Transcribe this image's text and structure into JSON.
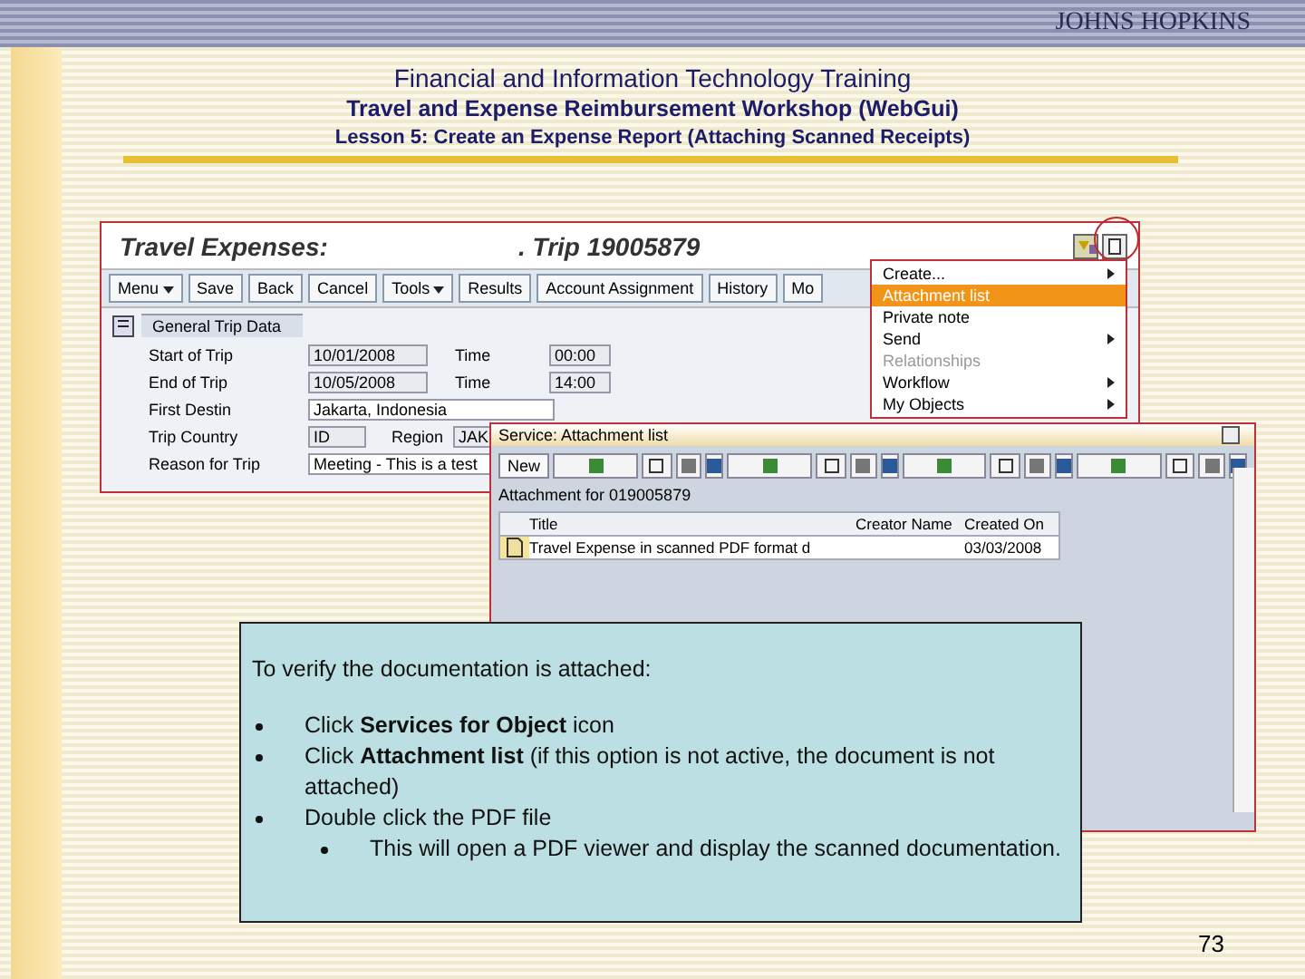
{
  "slide": {
    "logo": "JOHNS HOPKINS",
    "titles": [
      "Financial and Information Technology Training",
      "Travel and Expense Reimbursement Workshop (WebGui)",
      "Lesson 5: Create an Expense Report (Attaching Scanned Receipts)"
    ],
    "page_number": "73"
  },
  "sap": {
    "title": "Travel Expenses:",
    "trip": ". Trip 19005879",
    "toolbar": [
      {
        "label": "Menu",
        "dropdown": true
      },
      {
        "label": "Save",
        "dropdown": false
      },
      {
        "label": "Back",
        "dropdown": false
      },
      {
        "label": "Cancel",
        "dropdown": false
      },
      {
        "label": "Tools",
        "dropdown": true
      },
      {
        "label": "Results",
        "dropdown": false
      },
      {
        "label": "Account Assignment",
        "dropdown": false
      },
      {
        "label": "History",
        "dropdown": false
      },
      {
        "label": "Mo",
        "dropdown": false
      }
    ],
    "tab": "General Trip Data",
    "fields": [
      {
        "kind": "date",
        "label": "Start of Trip",
        "value": "10/01/2008",
        "label_2": "Time",
        "value_2": "00:00"
      },
      {
        "kind": "date",
        "label": "End of Trip",
        "value": "10/05/2008",
        "label_2": "Time",
        "value_2": "14:00"
      },
      {
        "kind": "text",
        "label": "First Destin",
        "value": "Jakarta, Indonesia"
      },
      {
        "kind": "code",
        "label": "Trip Country",
        "value": "ID",
        "label_2": "Region",
        "value_2": "JAK"
      },
      {
        "kind": "text",
        "label": "Reason for Trip",
        "value": "Meeting - This is a test"
      }
    ],
    "menu": [
      {
        "label": "Create...",
        "submenu": true,
        "selected": false,
        "disabled": false
      },
      {
        "label": "Attachment list",
        "submenu": false,
        "selected": true,
        "disabled": false
      },
      {
        "label": "Private note",
        "submenu": false,
        "selected": false,
        "disabled": false
      },
      {
        "label": "Send",
        "submenu": true,
        "selected": false,
        "disabled": false
      },
      {
        "label": "Relationships",
        "submenu": false,
        "selected": false,
        "disabled": true
      },
      {
        "label": "Workflow",
        "submenu": true,
        "selected": false,
        "disabled": false
      },
      {
        "label": "My Objects",
        "submenu": true,
        "selected": false,
        "disabled": false
      }
    ]
  },
  "popup": {
    "title": "Service: Attachment list",
    "new_button": "New",
    "caption": "Attachment for 019005879",
    "columns": [
      "Title",
      "Creator Name",
      "Created On"
    ],
    "rows": [
      {
        "title": "Travel Expense in scanned PDF format d",
        "created_on": "03/03/2008"
      }
    ]
  },
  "note": {
    "intro": "To verify the documentation is attached:",
    "bullets": [
      {
        "text": "Click **Services for Object** icon"
      },
      {
        "text": "Click **Attachment list** (if this option is not active, the document is not attached)"
      },
      {
        "text": "Double click the PDF file",
        "children": [
          {
            "text": "This will open a PDF viewer and display the scanned documentation."
          }
        ]
      }
    ]
  }
}
